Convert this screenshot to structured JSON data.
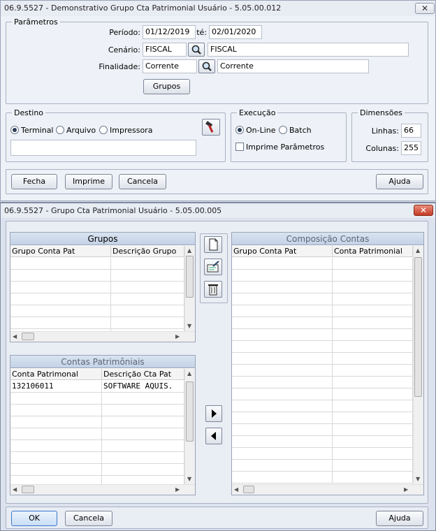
{
  "win1": {
    "title": "06.9.5527 - Demonstrativo Grupo Cta Patrimonial Usuário - 5.05.00.012",
    "close": "✕",
    "parametros": {
      "legend": "Parâmetros",
      "periodo_label": "Período:",
      "periodo_from": "01/12/2019",
      "ate_label": "té:",
      "periodo_to": "02/01/2020",
      "cenario_label": "Cenário:",
      "cenario_code": "FISCAL",
      "cenario_desc": "FISCAL",
      "finalidade_label": "Finalidade:",
      "finalidade_code": "Corrente",
      "finalidade_desc": "Corrente",
      "grupos_button": "Grupos"
    },
    "destino": {
      "legend": "Destino",
      "terminal": "Terminal",
      "arquivo": "Arquivo",
      "impressora": "Impressora",
      "file_value": ""
    },
    "execucao": {
      "legend": "Execução",
      "online": "On-Line",
      "batch": "Batch",
      "imprime": "Imprime Parâmetros"
    },
    "dimensoes": {
      "legend": "Dimensões",
      "linhas_label": "Linhas:",
      "linhas": "66",
      "colunas_label": "Colunas:",
      "colunas": "255"
    },
    "buttons": {
      "fecha": "Fecha",
      "imprime": "Imprime",
      "cancela": "Cancela",
      "ajuda": "Ajuda"
    }
  },
  "win2": {
    "title": "06.9.5527 - Grupo Cta Patrimonial Usuário - 5.05.00.005",
    "close": "✕",
    "grupos": {
      "title": "Grupos",
      "col1": "Grupo Conta Pat",
      "col2": "Descrição Grupo"
    },
    "contas": {
      "title": "Contas Patrimôniais",
      "col1": "Conta Patrimonal",
      "col2": "Descrição Cta Pat",
      "rows": [
        {
          "conta": "132106011",
          "desc": "SOFTWARE AQUIS."
        }
      ]
    },
    "composicao": {
      "title": "Composição Contas",
      "col1": "Grupo Conta Pat",
      "col2": "Conta Patrimonial"
    },
    "buttons": {
      "ok": "OK",
      "cancela": "Cancela",
      "ajuda": "Ajuda"
    }
  }
}
